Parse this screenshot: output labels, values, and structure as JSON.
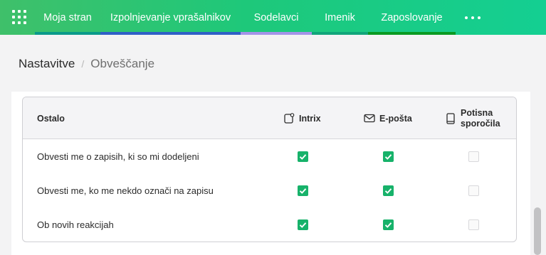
{
  "nav": {
    "tabs": [
      {
        "label": "Moja stran",
        "bar_color": "#0a9a8a"
      },
      {
        "label": "Izpolnjevanje vprašalnikov",
        "bar_color": "#2f5fc6"
      },
      {
        "label": "Sodelavci",
        "bar_color": "#a493e8"
      },
      {
        "label": "Imenik",
        "bar_color": "#11a57a"
      },
      {
        "label": "Zaposlovanje",
        "bar_color": "#0a9a22"
      }
    ]
  },
  "breadcrumb": {
    "root": "Nastavitve",
    "separator": "/",
    "current": "Obveščanje"
  },
  "table": {
    "headers": {
      "category": "Ostalo",
      "intrix": "Intrix",
      "email": "E-pošta",
      "push_line1": "Potisna",
      "push_line2": "sporočila"
    },
    "rows": [
      {
        "label": "Obvesti me o zapisih, ki so mi dodeljeni",
        "intrix": true,
        "email": true,
        "push": false
      },
      {
        "label": "Obvesti me, ko me nekdo označi na zapisu",
        "intrix": true,
        "email": true,
        "push": false
      },
      {
        "label": "Ob novih reakcijah",
        "intrix": true,
        "email": true,
        "push": false
      }
    ]
  },
  "colors": {
    "checked": "#17b26a",
    "nav_gradient_start": "#3fc06a",
    "nav_gradient_end": "#14cf92"
  }
}
